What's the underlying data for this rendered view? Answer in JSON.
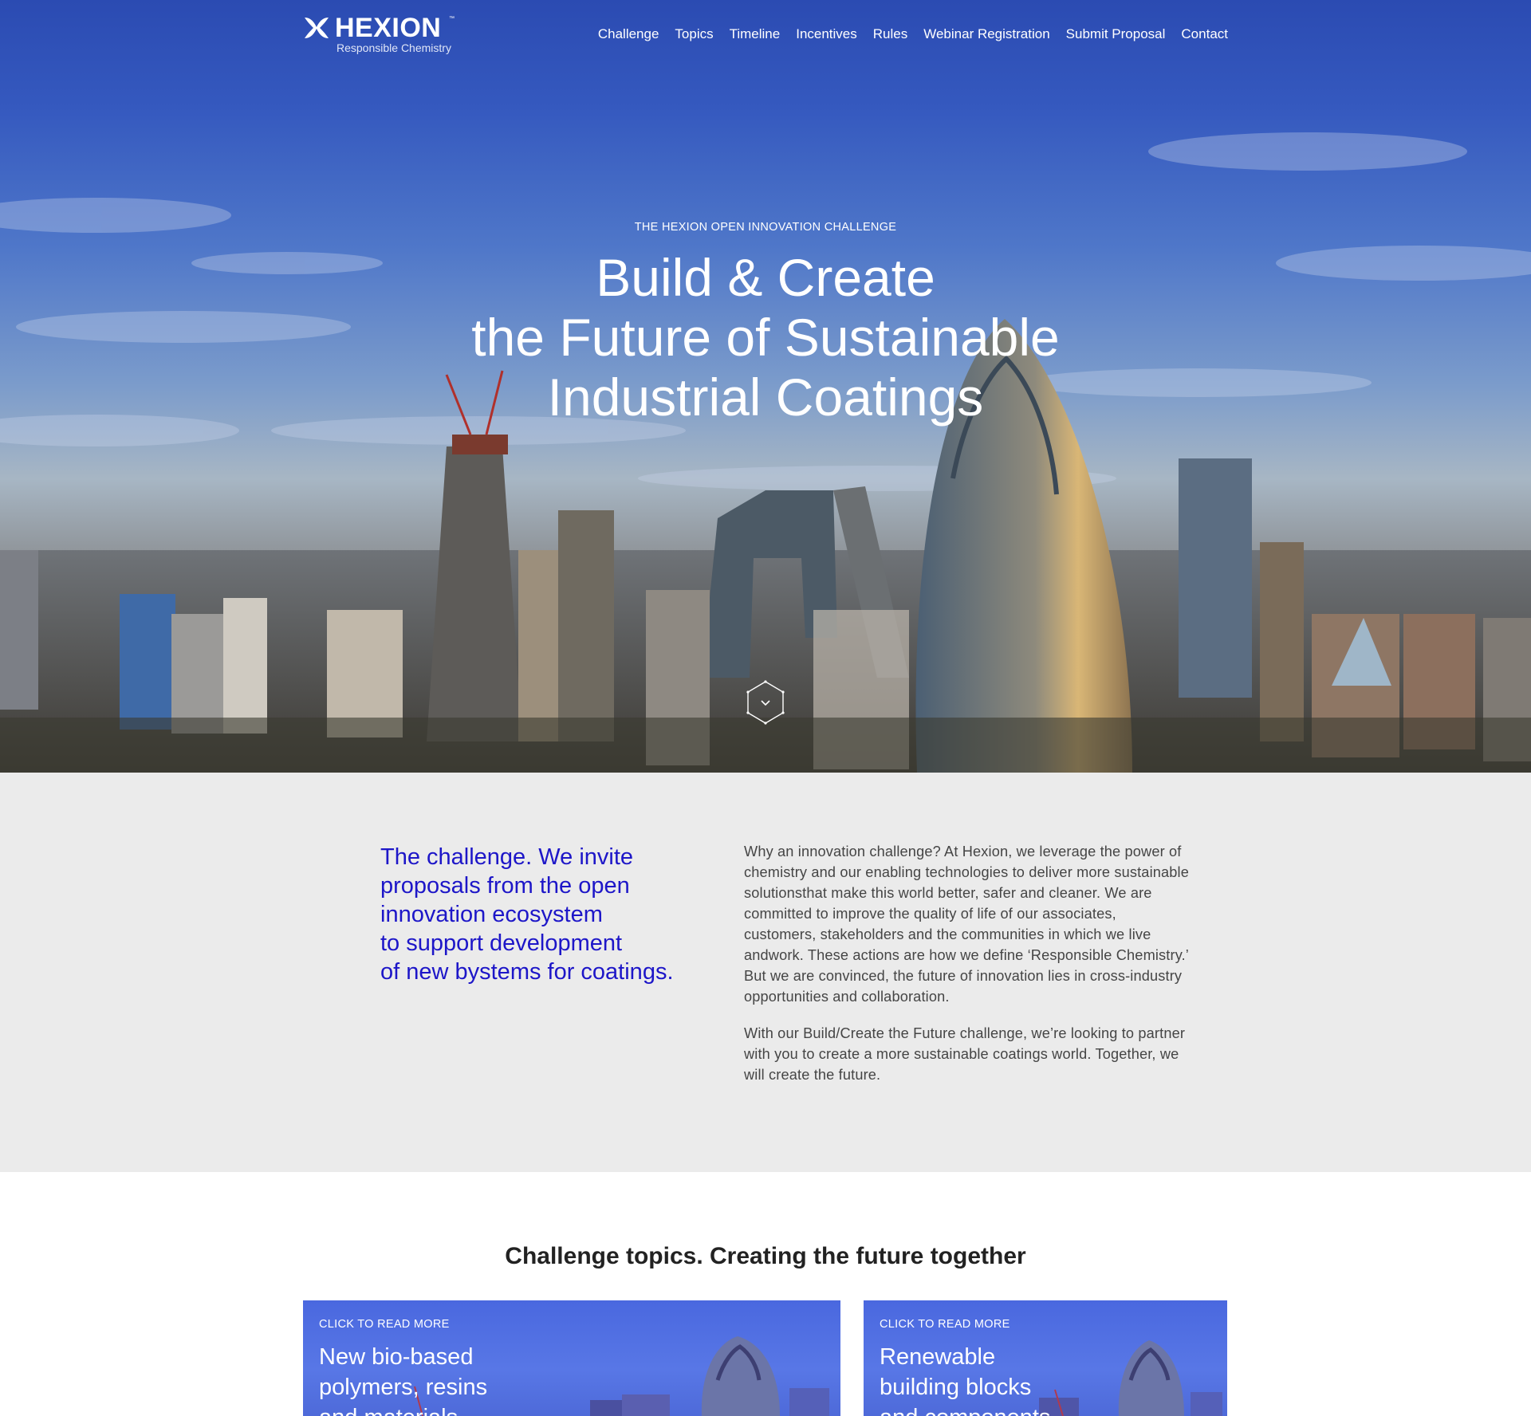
{
  "brand": {
    "name": "HEXION",
    "tagline": "Responsible Chemistry",
    "trademark": "™"
  },
  "nav": {
    "items": [
      {
        "label": "Challenge"
      },
      {
        "label": "Topics"
      },
      {
        "label": "Timeline"
      },
      {
        "label": "Incentives"
      },
      {
        "label": "Rules"
      },
      {
        "label": "Webinar Registration"
      },
      {
        "label": "Submit Proposal"
      },
      {
        "label": "Contact"
      }
    ]
  },
  "hero": {
    "kicker": "THE HEXION OPEN INNOVATION CHALLENGE",
    "title_lines": [
      "Build & Create",
      "the Future of Sustainable",
      "Industrial Coatings"
    ],
    "scroll_icon": "chevron-down-hexagon-icon"
  },
  "intro": {
    "lead_lines": [
      "The challenge. We invite",
      "proposals from the open",
      "innovation ecosystem",
      "to support development",
      "of new bystems for coatings."
    ],
    "paragraphs": [
      "Why an innovation challenge? At Hexion, we leverage the power of chemistry and our enabling technologies to deliver more sustainable solutionsthat make this world better, safer and cleaner. We are committed to improve the quality of life of our associates, customers, stakeholders and the communities in which we live andwork. These actions are how we define ‘Responsible Chemistry.’ But we are convinced, the future of innovation lies in cross-industry opportunities and collaboration.",
      "With our Build/Create the Future challenge, we’re looking to partner with you to create a more sustainable coatings world. Together, we will create the future."
    ]
  },
  "topics": {
    "title": "Challenge topics. Creating the future together",
    "cards": [
      {
        "kicker": "CLICK TO READ MORE",
        "title_lines": [
          "New bio-based",
          "polymers, resins",
          "and materials"
        ]
      },
      {
        "kicker": "CLICK TO READ MORE",
        "title_lines": [
          "Renewable",
          "building blocks",
          "and components"
        ]
      }
    ]
  },
  "colors": {
    "accent": "#1d16c8",
    "hero_sky": "#2b4bb2",
    "intro_bg": "#ebebeb",
    "card_bg": "#4a68df"
  }
}
